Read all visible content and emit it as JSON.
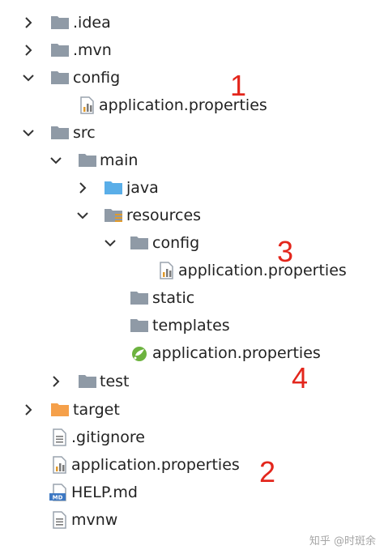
{
  "tree": {
    "items": [
      {
        "label": ".idea",
        "icon": "folder-icon",
        "state": "collapsed"
      },
      {
        "label": ".mvn",
        "icon": "folder-icon",
        "state": "collapsed"
      },
      {
        "label": "config",
        "icon": "folder-icon",
        "state": "expanded"
      },
      {
        "label": "application.properties",
        "icon": "properties-file-icon"
      },
      {
        "label": "src",
        "icon": "folder-icon",
        "state": "expanded"
      },
      {
        "label": "main",
        "icon": "folder-icon",
        "state": "expanded"
      },
      {
        "label": "java",
        "icon": "source-folder-icon",
        "state": "collapsed"
      },
      {
        "label": "resources",
        "icon": "resources-folder-icon",
        "state": "expanded"
      },
      {
        "label": "config",
        "icon": "folder-icon",
        "state": "expanded"
      },
      {
        "label": "application.properties",
        "icon": "properties-file-icon"
      },
      {
        "label": "static",
        "icon": "folder-icon"
      },
      {
        "label": "templates",
        "icon": "folder-icon"
      },
      {
        "label": "application.properties",
        "icon": "spring-properties-file-icon"
      },
      {
        "label": "test",
        "icon": "folder-icon",
        "state": "collapsed"
      },
      {
        "label": "target",
        "icon": "excluded-folder-icon",
        "state": "collapsed"
      },
      {
        "label": ".gitignore",
        "icon": "text-file-icon"
      },
      {
        "label": "application.properties",
        "icon": "properties-file-icon"
      },
      {
        "label": "HELP.md",
        "icon": "markdown-file-icon"
      },
      {
        "label": "mvnw",
        "icon": "text-file-icon"
      }
    ]
  },
  "annotations": [
    "1",
    "2",
    "3",
    "4"
  ],
  "watermark": "知乎 @时斑余",
  "colors": {
    "folder": "#8f9aa6",
    "source_folder": "#5aaee8",
    "excluded_folder": "#f5a04a",
    "annotation": "#e3261c",
    "spring_green": "#6db33f"
  }
}
